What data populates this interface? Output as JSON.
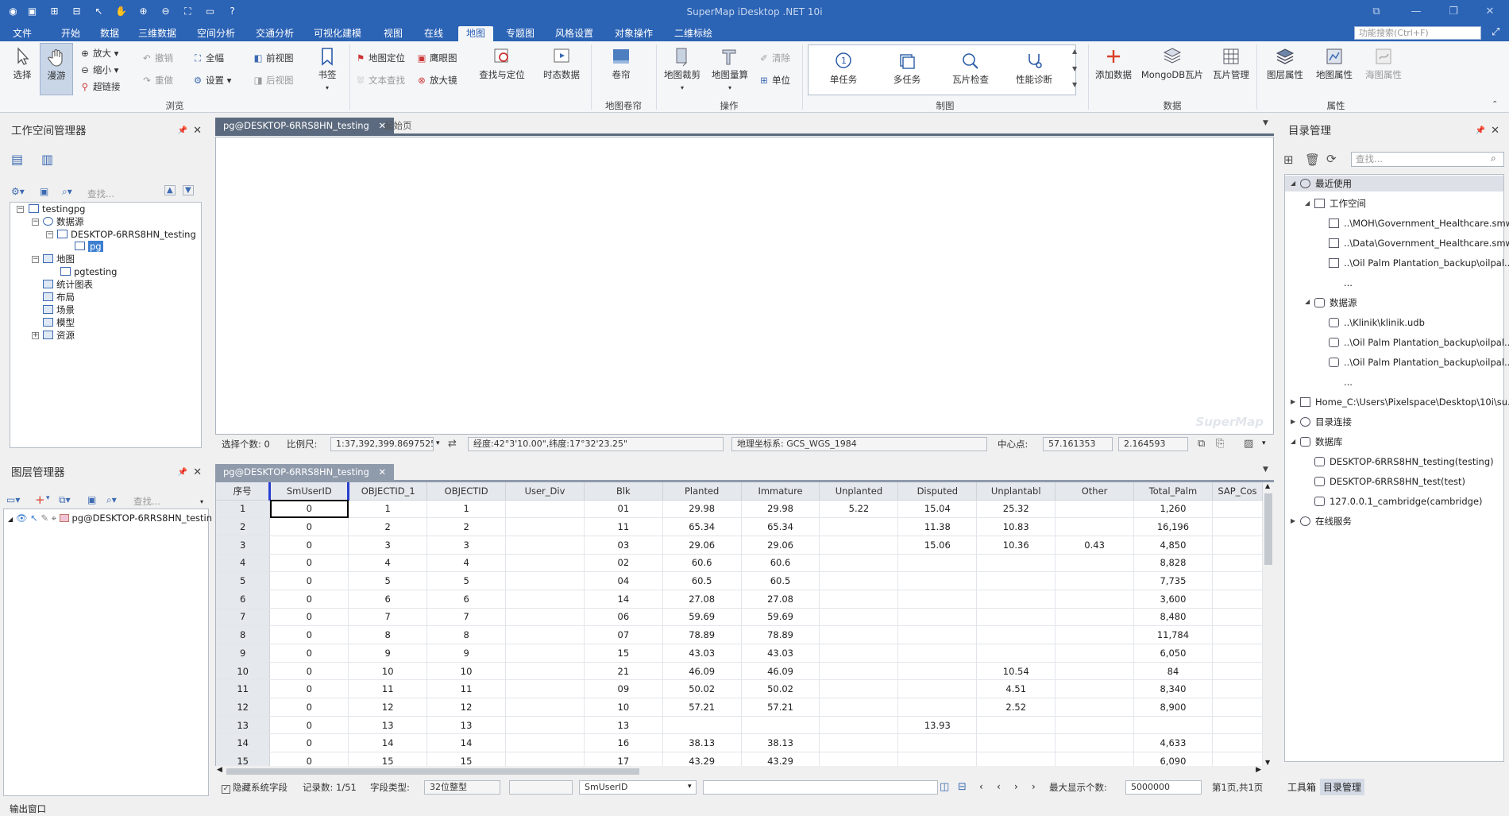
{
  "app": {
    "title": "SuperMap iDesktop .NET 10i",
    "search_placeholder": "功能搜索(Ctrl+F)"
  },
  "menu": [
    "文件",
    "开始",
    "数据",
    "三维数据",
    "空间分析",
    "交通分析",
    "可视化建模",
    "视图",
    "在线",
    "地图",
    "专题图",
    "风格设置",
    "对象操作",
    "二维标绘"
  ],
  "ribbon": {
    "browse": {
      "select": "选择",
      "pan": "漫游",
      "zoom_in": "放大",
      "zoom_out": "缩小",
      "hyperlink": "超链接",
      "undo": "撤销",
      "redo": "重做",
      "full": "全幅",
      "settings": "设置",
      "prev_view": "前视图",
      "next_view": "后视图",
      "bookmark": "书签",
      "label": "浏览"
    },
    "locate": {
      "map_locate": "地图定位",
      "eagle_eye": "鹰眼图",
      "text_search": "文本查找",
      "magnifier": "放大镜",
      "find_locate": "查找与定位",
      "dynamic_data": "时态数据"
    },
    "scroll": {
      "roller": "卷帘",
      "label": "地图卷帘"
    },
    "ops": {
      "clip": "地图裁剪",
      "measure": "地图量算",
      "clear": "清除",
      "unit": "单位",
      "label": "操作"
    },
    "mapping": {
      "single": "单任务",
      "multi": "多任务",
      "tile_check": "瓦片检查",
      "perf": "性能诊断",
      "label": "制图"
    },
    "data": {
      "add_data": "添加数据",
      "mongodb": "MongoDB瓦片",
      "tile_mgr": "瓦片管理",
      "label": "数据"
    },
    "props": {
      "layer_props": "图层属性",
      "map_props": "地图属性",
      "chart_props": "海图属性",
      "label": "属性"
    }
  },
  "workspace": {
    "title": "工作空间管理器",
    "search": "查找...",
    "tree": [
      "testingpg",
      "数据源",
      "DESKTOP-6RRS8HN_testing",
      "pg",
      "地图",
      "pgtesting",
      "统计图表",
      "布局",
      "场景",
      "模型",
      "资源"
    ]
  },
  "layers": {
    "title": "图层管理器",
    "search": "查找...",
    "item": "pg@DESKTOP-6RRS8HN_testin"
  },
  "tabs": {
    "map_tab": "pg@DESKTOP-6RRS8HN_testing",
    "start_tab": "起始页",
    "table_tab": "pg@DESKTOP-6RRS8HN_testing"
  },
  "watermark": "SuperMap",
  "status": {
    "sel_label": "选择个数: 0",
    "scale_label": "比例尺:",
    "scale": "1:37,392,399.8697525",
    "coord": "经度:42°3'10.00\",纬度:17°32'23.25\"",
    "crs": "地理坐标系: GCS_WGS_1984",
    "center_label": "中心点:",
    "center_x": "57.161353",
    "center_y": "2.164593"
  },
  "grid": {
    "columns": [
      "序号",
      "SmUserID",
      "OBJECTID_1",
      "OBJECTID",
      "User_Div",
      "Blk",
      "Planted",
      "Immature",
      "Unplanted",
      "Disputed",
      "Unplantabl",
      "Other",
      "Total_Palm",
      "SAP_Cos"
    ],
    "rows": [
      [
        "1",
        "0",
        "1",
        "1",
        "",
        "01",
        "29.98",
        "29.98",
        "5.22",
        "15.04",
        "25.32",
        "",
        "1,260",
        ""
      ],
      [
        "2",
        "0",
        "2",
        "2",
        "",
        "11",
        "65.34",
        "65.34",
        "",
        "11.38",
        "10.83",
        "",
        "16,196",
        ""
      ],
      [
        "3",
        "0",
        "3",
        "3",
        "",
        "03",
        "29.06",
        "29.06",
        "",
        "15.06",
        "10.36",
        "0.43",
        "4,850",
        ""
      ],
      [
        "4",
        "0",
        "4",
        "4",
        "",
        "02",
        "60.6",
        "60.6",
        "",
        "",
        "",
        "",
        "8,828",
        ""
      ],
      [
        "5",
        "0",
        "5",
        "5",
        "",
        "04",
        "60.5",
        "60.5",
        "",
        "",
        "",
        "",
        "7,735",
        ""
      ],
      [
        "6",
        "0",
        "6",
        "6",
        "",
        "14",
        "27.08",
        "27.08",
        "",
        "",
        "",
        "",
        "3,600",
        ""
      ],
      [
        "7",
        "0",
        "7",
        "7",
        "",
        "06",
        "59.69",
        "59.69",
        "",
        "",
        "",
        "",
        "8,480",
        ""
      ],
      [
        "8",
        "0",
        "8",
        "8",
        "",
        "07",
        "78.89",
        "78.89",
        "",
        "",
        "",
        "",
        "11,784",
        ""
      ],
      [
        "9",
        "0",
        "9",
        "9",
        "",
        "15",
        "43.03",
        "43.03",
        "",
        "",
        "",
        "",
        "6,050",
        ""
      ],
      [
        "10",
        "0",
        "10",
        "10",
        "",
        "21",
        "46.09",
        "46.09",
        "",
        "",
        "10.54",
        "",
        "84",
        ""
      ],
      [
        "11",
        "0",
        "11",
        "11",
        "",
        "09",
        "50.02",
        "50.02",
        "",
        "",
        "4.51",
        "",
        "8,340",
        ""
      ],
      [
        "12",
        "0",
        "12",
        "12",
        "",
        "10",
        "57.21",
        "57.21",
        "",
        "",
        "2.52",
        "",
        "8,900",
        ""
      ],
      [
        "13",
        "0",
        "13",
        "13",
        "",
        "13",
        "",
        "",
        "",
        "13.93",
        "",
        "",
        "",
        ""
      ],
      [
        "14",
        "0",
        "14",
        "14",
        "",
        "16",
        "38.13",
        "38.13",
        "",
        "",
        "",
        "",
        "4,633",
        ""
      ],
      [
        "15",
        "0",
        "15",
        "15",
        "",
        "17",
        "43.29",
        "43.29",
        "",
        "",
        "",
        "",
        "6,090",
        ""
      ]
    ]
  },
  "footer": {
    "hide_sys": "隐藏系统字段",
    "records": "记录数: 1/51",
    "field_type_label": "字段类型:",
    "field_type": "32位整型",
    "field": "SmUserID",
    "max_label": "最大显示个数:",
    "max_value": "5000000",
    "page": "第1页,共1页"
  },
  "catalog": {
    "title": "目录管理",
    "search": "查找...",
    "recent": "最近使用",
    "workspace": "工作空间",
    "ws_items": [
      "..\\MOH\\Government_Healthcare.smwu",
      "..\\Data\\Government_Healthcare.smwu",
      "..\\Oil Palm Plantation_backup\\oilpal..."
    ],
    "more": "...",
    "datasource": "数据源",
    "ds_items": [
      "..\\Klinik\\klinik.udb",
      "..\\Oil Palm Plantation_backup\\oilpal...",
      "..\\Oil Palm Plantation_backup\\oilpal..."
    ],
    "home": "Home_C:\\Users\\Pixelspace\\Desktop\\10i\\su...",
    "dir_link": "目录连接",
    "database": "数据库",
    "db_items": [
      "DESKTOP-6RRS8HN_testing(testing)",
      "DESKTOP-6RRS8HN_test(test)",
      "127.0.0.1_cambridge(cambridge)"
    ],
    "online": "在线服务",
    "tab_toolbox": "工具箱",
    "tab_catalog": "目录管理"
  },
  "output": "输出窗口"
}
